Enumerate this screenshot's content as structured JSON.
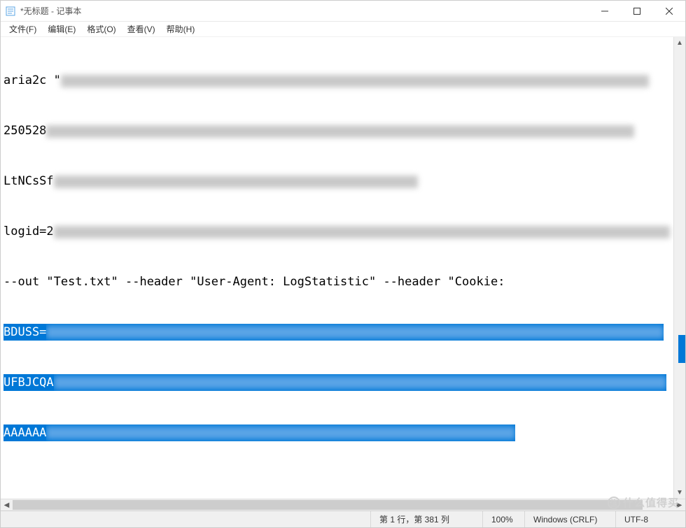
{
  "window": {
    "title": "*无标题 - 记事本"
  },
  "menu": {
    "file": "文件(F)",
    "edit": "编辑(E)",
    "format": "格式(O)",
    "view": "查看(V)",
    "help": "帮助(H)"
  },
  "content": {
    "line1_prefix": "aria2c \"",
    "line2_prefix": "250528",
    "line3_prefix": "LtNCsSf",
    "line4_prefix": "logid=2",
    "line5": "--out \"Test.txt\" --header \"User-Agent: LogStatistic\" --header \"Cookie:",
    "line6_prefix": "BDUSS=",
    "line7_prefix": "UFBJCQA",
    "line8_prefix": "AAAAAA"
  },
  "statusbar": {
    "position": "第 1 行，第 381 列",
    "zoom": "100%",
    "line_ending": "Windows (CRLF)",
    "encoding": "UTF-8"
  },
  "watermark": {
    "brand": "值",
    "text": "什么值得买"
  }
}
